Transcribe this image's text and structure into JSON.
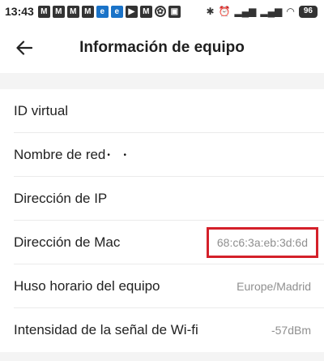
{
  "status_bar": {
    "time": "13:43",
    "notifications": [
      {
        "icon": "mail-icon",
        "glyph": "M",
        "style": "dark"
      },
      {
        "icon": "mail-icon",
        "glyph": "M",
        "style": "dark"
      },
      {
        "icon": "mail-icon",
        "glyph": "M",
        "style": "dark"
      },
      {
        "icon": "mail-icon",
        "glyph": "M",
        "style": "dark"
      },
      {
        "icon": "edge-icon",
        "glyph": "e",
        "style": "blue"
      },
      {
        "icon": "edge-icon",
        "glyph": "e",
        "style": "blue"
      },
      {
        "icon": "youtube-icon",
        "glyph": "▶",
        "style": "dark"
      },
      {
        "icon": "mail-icon",
        "glyph": "M",
        "style": "dark"
      },
      {
        "icon": "app-icon",
        "glyph": "✿",
        "style": "ring"
      },
      {
        "icon": "image-icon",
        "glyph": "▣",
        "style": "dark"
      }
    ],
    "system_glyphs": [
      "✱",
      "⏰",
      "▂▄▆",
      "▂▄▆",
      "◠"
    ],
    "battery": "96"
  },
  "header": {
    "title": "Información de equipo"
  },
  "rows": [
    {
      "label": "ID virtual",
      "value": ""
    },
    {
      "label": "Nombre de red",
      "value": ""
    },
    {
      "label": "Dirección de IP",
      "value": ""
    },
    {
      "label": "Dirección de Mac",
      "value": "68:c6:3a:eb:3d:6d"
    },
    {
      "label": "Huso horario del equipo",
      "value": "Europe/Madrid"
    },
    {
      "label": "Intensidad de la señal de Wi-fi",
      "value": "-57dBm"
    }
  ],
  "colors": {
    "highlight_box": "#d4202a",
    "section_gap": "#f4f4f4",
    "value_text": "#8f8f8f"
  }
}
